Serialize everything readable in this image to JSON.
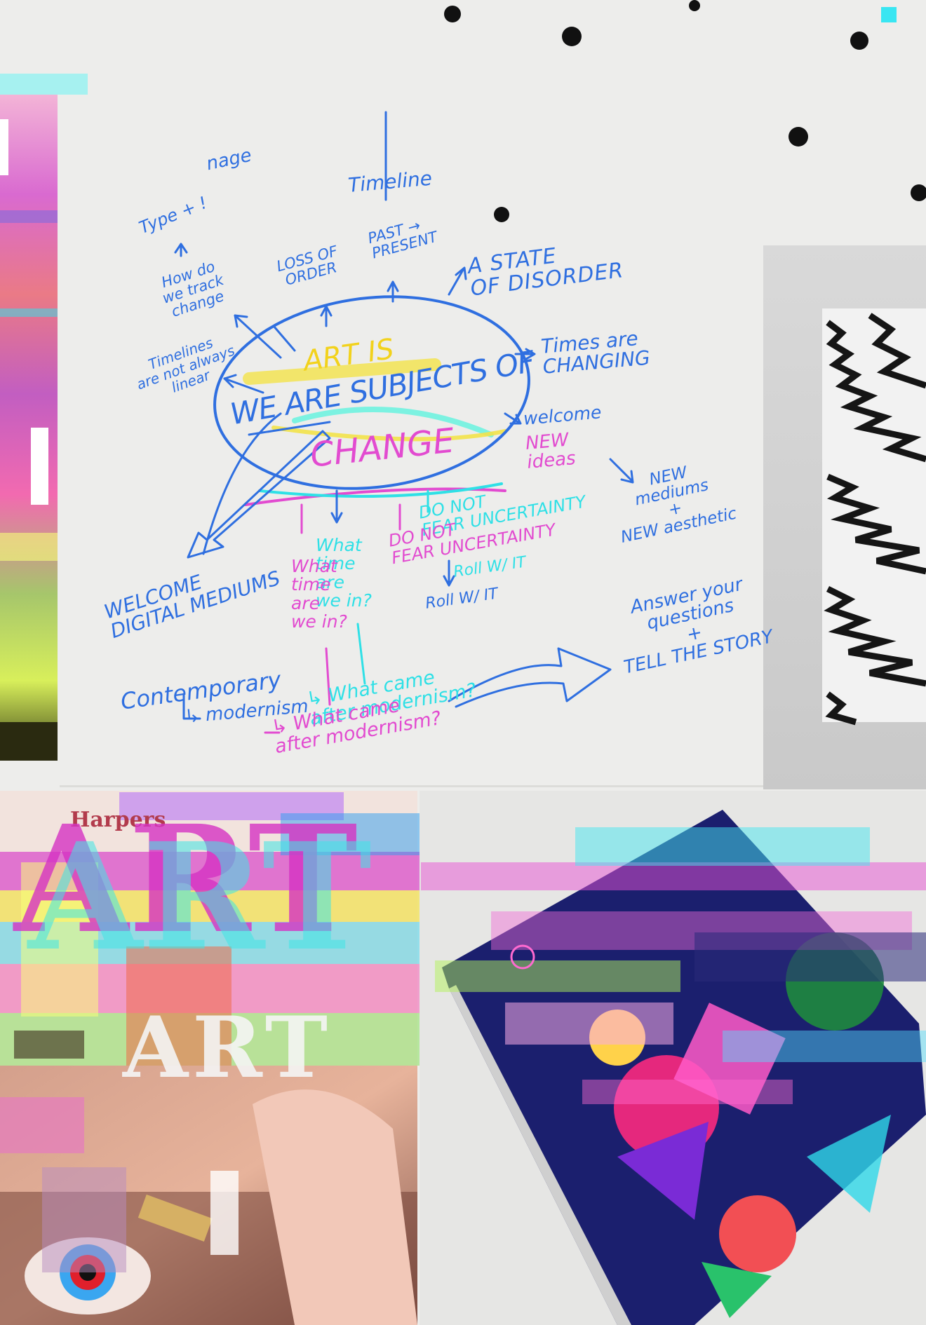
{
  "colors": {
    "background": "#ededeb",
    "pen_blue": "#2f6fe0",
    "highlighter_pink": "#e24bd0",
    "highlighter_cyan": "#2fe0e6",
    "highlighter_yellow": "#f2d21c"
  },
  "mindmap": {
    "center": {
      "art_is": "ART IS",
      "we_are_subjects_of": "WE ARE SUBJECTS OF",
      "change": "CHANGE"
    },
    "nodes": {
      "nage": "nage",
      "type": "Type + !",
      "how_track": "How do\nwe track\nchange",
      "timelines_not_linear": "Timelines\nare not always\nlinear",
      "loss_of_order": "LOSS OF\nORDER",
      "timeline": "Timeline",
      "past_present": "PAST →\nPRESENT",
      "state_of_disorder": "A STATE\nOF DISORDER",
      "times_changing": "Times are\nCHANGING",
      "welcome": "welcome",
      "new_ideas": "NEW\nideas",
      "new_mediums": "NEW\nmediums\n+\nNEW aesthetic",
      "do_not_fear_cyan": "DO NOT\nFEAR UNCERTAINTY",
      "do_not_fear_pink": "DO NOT\nFEAR UNCERTAINTY",
      "roll_with_it_cyan": "Roll W/ IT",
      "roll_with_it_blue": "Roll W/ IT",
      "what_time_cyan": "What\ntime\nare\nwe in?",
      "what_time_pink": "What\ntime\nare\nwe in?",
      "welcome_digital": "WELCOME\nDIGITAL MEDIUMS",
      "contemporary": "Contemporary",
      "modernism": "↳ modernism",
      "what_came_after_cyan": "↳ What came\nafter modernism?",
      "what_came_after_pink": "↳ What came\nafter modernism?",
      "answer_questions": "Answer your\nquestions\n+\nTELL THE STORY"
    }
  },
  "magazine": {
    "masthead": "Harpers",
    "big_letters": "ART",
    "sub_letters": "ART"
  },
  "icons": {
    "dots": "black-dot-icon",
    "arrow": "curved-arrow-icon"
  }
}
